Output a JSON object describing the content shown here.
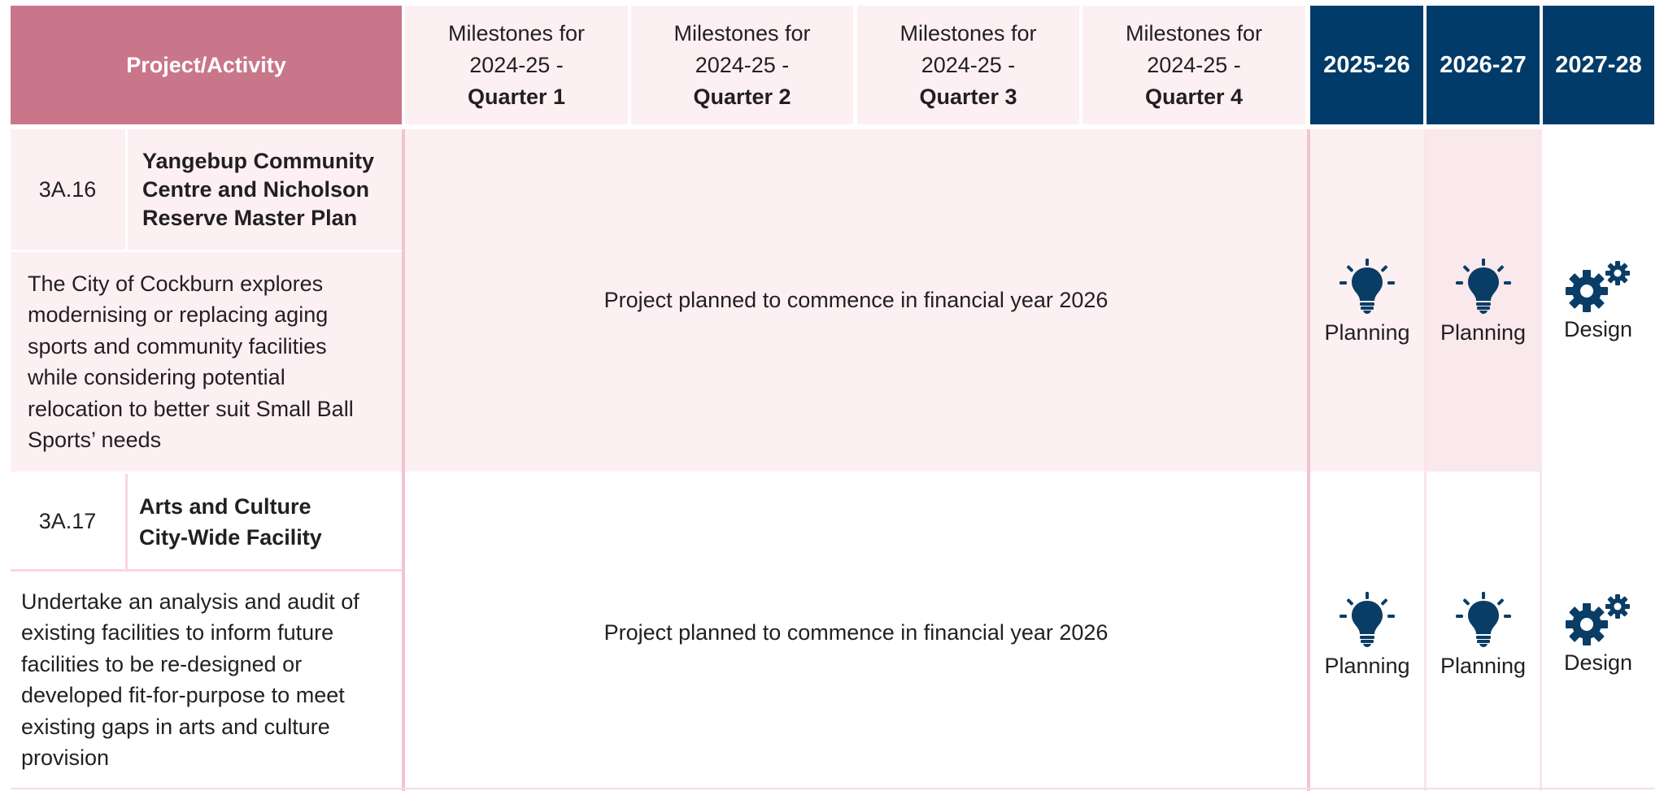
{
  "header": {
    "project_label": "Project/Activity",
    "quarters": [
      {
        "line1": "Milestones for",
        "line2": "2024-25 -",
        "quarter": "Quarter 1"
      },
      {
        "line1": "Milestones for",
        "line2": "2024-25 -",
        "quarter": "Quarter 2"
      },
      {
        "line1": "Milestones for",
        "line2": "2024-25 -",
        "quarter": "Quarter 3"
      },
      {
        "line1": "Milestones for",
        "line2": "2024-25 -",
        "quarter": "Quarter 4"
      }
    ],
    "years": [
      "2025-26",
      "2026-27",
      "2027-28"
    ]
  },
  "colors": {
    "header_project_bg": "#c9768b",
    "header_quarter_bg": "#fcf0f3",
    "header_year_bg": "#003b69",
    "row_pink_bg": "#fcf0f3",
    "icon_color": "#0a3d66",
    "divider_pink": "#f4c4cf"
  },
  "rows": [
    {
      "code": "3A.16",
      "title_lines": [
        "Yangebup Community",
        "Centre and Nicholson",
        "Reserve Master Plan"
      ],
      "description_lines": [
        "The City of Cockburn explores",
        "modernising or replacing aging",
        "sports and community facilities",
        "while considering potential",
        "relocation to better suit Small Ball",
        "Sports’ needs"
      ],
      "milestone_text": "Project planned to commence in financial year 2026",
      "stages": [
        {
          "icon": "lightbulb-icon",
          "label": "Planning"
        },
        {
          "icon": "lightbulb-icon",
          "label": "Planning"
        },
        {
          "icon": "gears-icon",
          "label": "Design"
        }
      ]
    },
    {
      "code": "3A.17",
      "title_lines": [
        "Arts and Culture",
        "City-Wide Facility"
      ],
      "description_lines": [
        "Undertake an analysis and audit of",
        "existing facilities to inform future",
        "facilities to be re-designed or",
        "developed fit-for-purpose to meet",
        "existing gaps in arts and culture",
        "provision"
      ],
      "milestone_text": "Project planned to commence in financial year 2026",
      "stages": [
        {
          "icon": "lightbulb-icon",
          "label": "Planning"
        },
        {
          "icon": "lightbulb-icon",
          "label": "Planning"
        },
        {
          "icon": "gears-icon",
          "label": "Design"
        }
      ]
    }
  ]
}
